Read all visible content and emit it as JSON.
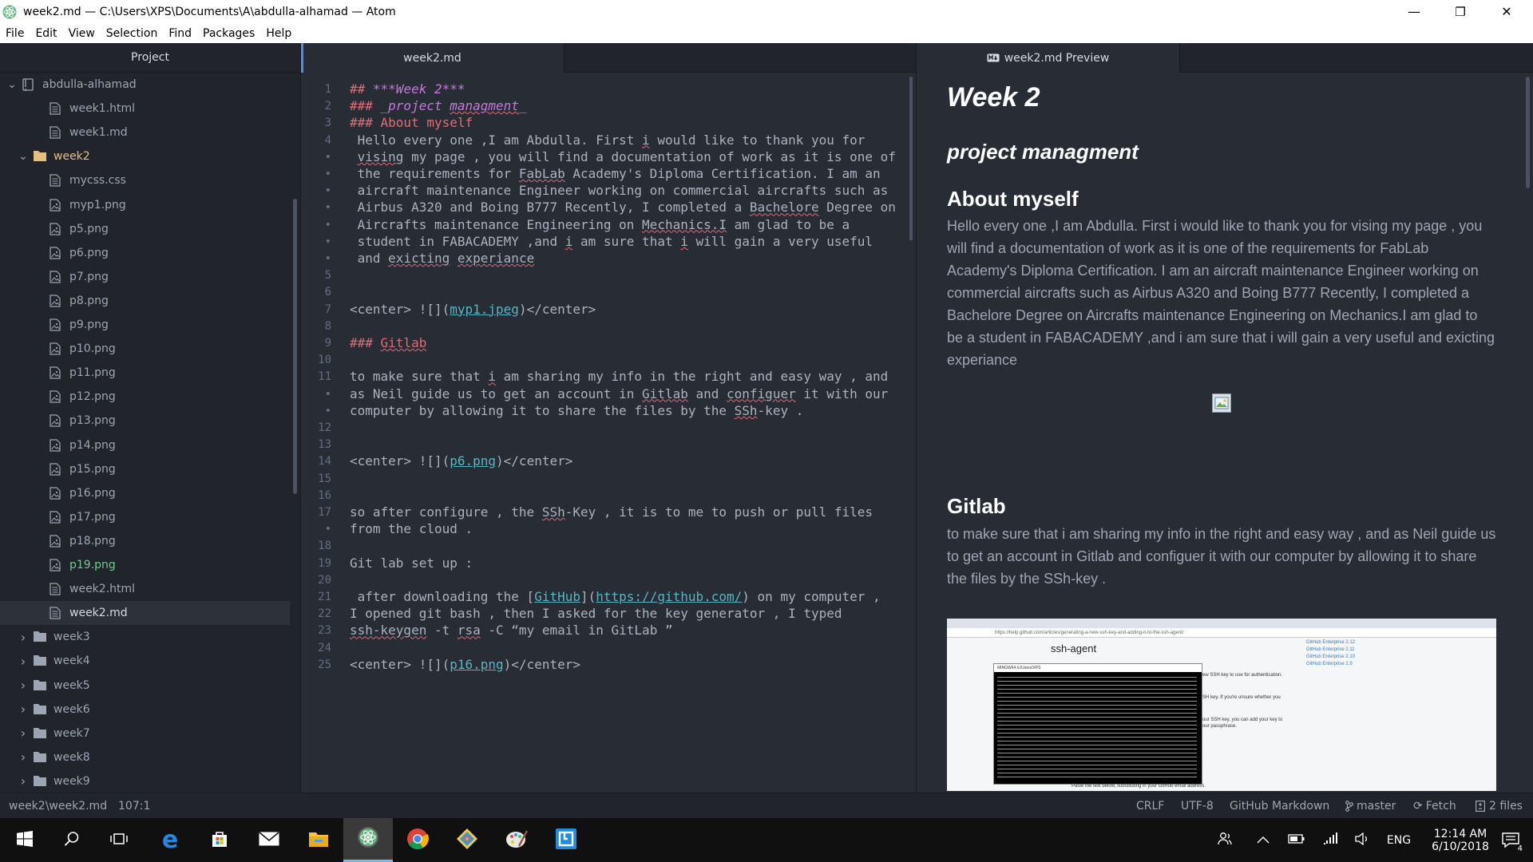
{
  "window": {
    "title": "week2.md — C:\\Users\\XPS\\Documents\\A\\abdulla-alhamad — Atom",
    "minimize": "—",
    "maximize": "❐",
    "close": "✕"
  },
  "menu": [
    "File",
    "Edit",
    "View",
    "Selection",
    "Find",
    "Packages",
    "Help"
  ],
  "tree": {
    "header": "Project",
    "items": [
      {
        "label": "abdulla-alhamad",
        "type": "repo",
        "depth": 0,
        "expanded": true
      },
      {
        "label": "week1.html",
        "type": "file",
        "depth": 2
      },
      {
        "label": "week1.md",
        "type": "file",
        "depth": 2
      },
      {
        "label": "week2",
        "type": "folder",
        "depth": 1,
        "expanded": true,
        "open": true
      },
      {
        "label": "mycss.css",
        "type": "file",
        "depth": 2
      },
      {
        "label": "myp1.png",
        "type": "image",
        "depth": 2
      },
      {
        "label": "p5.png",
        "type": "image",
        "depth": 2
      },
      {
        "label": "p6.png",
        "type": "image",
        "depth": 2
      },
      {
        "label": "p7.png",
        "type": "image",
        "depth": 2
      },
      {
        "label": "p8.png",
        "type": "image",
        "depth": 2
      },
      {
        "label": "p9.png",
        "type": "image",
        "depth": 2
      },
      {
        "label": "p10.png",
        "type": "image",
        "depth": 2
      },
      {
        "label": "p11.png",
        "type": "image",
        "depth": 2
      },
      {
        "label": "p12.png",
        "type": "image",
        "depth": 2
      },
      {
        "label": "p13.png",
        "type": "image",
        "depth": 2
      },
      {
        "label": "p14.png",
        "type": "image",
        "depth": 2
      },
      {
        "label": "p15.png",
        "type": "image",
        "depth": 2
      },
      {
        "label": "p16.png",
        "type": "image",
        "depth": 2
      },
      {
        "label": "p17.png",
        "type": "image",
        "depth": 2
      },
      {
        "label": "p18.png",
        "type": "image",
        "depth": 2
      },
      {
        "label": "p19.png",
        "type": "image",
        "depth": 2,
        "added": true
      },
      {
        "label": "week2.html",
        "type": "file",
        "depth": 2
      },
      {
        "label": "week2.md",
        "type": "file",
        "depth": 2,
        "selected": true
      },
      {
        "label": "week3",
        "type": "folder",
        "depth": 1
      },
      {
        "label": "week4",
        "type": "folder",
        "depth": 1
      },
      {
        "label": "week5",
        "type": "folder",
        "depth": 1
      },
      {
        "label": "week6",
        "type": "folder",
        "depth": 1
      },
      {
        "label": "week7",
        "type": "folder",
        "depth": 1
      },
      {
        "label": "week8",
        "type": "folder",
        "depth": 1
      },
      {
        "label": "week9",
        "type": "folder",
        "depth": 1
      }
    ]
  },
  "editor": {
    "tab": "week2.md",
    "lines": [
      {
        "n": "1",
        "parts": [
          [
            "hdr",
            "## "
          ],
          [
            "hdr-em",
            "***Week 2***"
          ]
        ]
      },
      {
        "n": "2",
        "parts": [
          [
            "hdr",
            "### "
          ],
          [
            "hdr-em",
            "_project "
          ],
          [
            "hdr-em sq",
            "managment"
          ],
          [
            "hdr-em",
            "_"
          ]
        ]
      },
      {
        "n": "3",
        "parts": [
          [
            "hdr",
            "### About myself"
          ]
        ]
      },
      {
        "n": "4",
        "parts": [
          [
            "",
            " Hello every one ,I am Abdulla. First "
          ],
          [
            "sq",
            "i"
          ],
          [
            "",
            " would like to thank you for"
          ]
        ]
      },
      {
        "n": "•",
        "parts": [
          [
            "",
            " "
          ],
          [
            "sq",
            "vising"
          ],
          [
            "",
            " my page , you will find a documentation of work as it is one of"
          ]
        ]
      },
      {
        "n": "•",
        "parts": [
          [
            "",
            " the requirements for "
          ],
          [
            "sq",
            "FabLab"
          ],
          [
            "",
            " Academy's Diploma Certification. I am an"
          ]
        ]
      },
      {
        "n": "•",
        "parts": [
          [
            "",
            " aircraft maintenance Engineer working on commercial aircrafts such as"
          ]
        ]
      },
      {
        "n": "•",
        "parts": [
          [
            "",
            " Airbus A320 and Boing B777 Recently, I completed a "
          ],
          [
            "sq",
            "Bachelore"
          ],
          [
            "",
            " Degree on"
          ]
        ]
      },
      {
        "n": "•",
        "parts": [
          [
            "",
            " Aircrafts maintenance Engineering on "
          ],
          [
            "sq",
            "Mechanics.I"
          ],
          [
            "",
            " am glad to be a"
          ]
        ]
      },
      {
        "n": "•",
        "parts": [
          [
            "",
            " student in FABACADEMY ,and "
          ],
          [
            "sq",
            "i"
          ],
          [
            "",
            " am sure that "
          ],
          [
            "sq",
            "i"
          ],
          [
            "",
            " will gain a very useful"
          ]
        ]
      },
      {
        "n": "•",
        "parts": [
          [
            "",
            " and "
          ],
          [
            "sq",
            "exicting"
          ],
          [
            "",
            " "
          ],
          [
            "sq",
            "experiance"
          ]
        ]
      },
      {
        "n": "5",
        "parts": []
      },
      {
        "n": "6",
        "parts": []
      },
      {
        "n": "7",
        "parts": [
          [
            "",
            "<center> ![]("
          ],
          [
            "url",
            "myp1.jpeg"
          ],
          [
            "",
            ")</center>"
          ]
        ]
      },
      {
        "n": "8",
        "parts": []
      },
      {
        "n": "9",
        "parts": [
          [
            "hdr",
            "### "
          ],
          [
            "hdr sq",
            "Gitlab"
          ]
        ]
      },
      {
        "n": "10",
        "parts": []
      },
      {
        "n": "11",
        "parts": [
          [
            "",
            "to make sure that "
          ],
          [
            "sq",
            "i"
          ],
          [
            "",
            " am sharing my info in the right and easy way , and"
          ]
        ]
      },
      {
        "n": "•",
        "parts": [
          [
            "",
            "as Neil guide us to get an account in "
          ],
          [
            "sq",
            "Gitlab"
          ],
          [
            "",
            " and "
          ],
          [
            "sq",
            "configuer"
          ],
          [
            "",
            " it with our"
          ]
        ]
      },
      {
        "n": "•",
        "parts": [
          [
            "",
            "computer by allowing it to share the files by the "
          ],
          [
            "sq",
            "SSh"
          ],
          [
            "",
            "-key ."
          ]
        ]
      },
      {
        "n": "12",
        "parts": []
      },
      {
        "n": "13",
        "parts": []
      },
      {
        "n": "14",
        "parts": [
          [
            "",
            "<center> ![]("
          ],
          [
            "url",
            "p6.png"
          ],
          [
            "",
            ")</center>"
          ]
        ]
      },
      {
        "n": "15",
        "parts": []
      },
      {
        "n": "16",
        "parts": []
      },
      {
        "n": "17",
        "parts": [
          [
            "",
            "so after configure , the "
          ],
          [
            "sq",
            "SSh"
          ],
          [
            "",
            "-Key , it is to me to push or pull files"
          ]
        ]
      },
      {
        "n": "•",
        "parts": [
          [
            "",
            "from the cloud ."
          ]
        ]
      },
      {
        "n": "18",
        "parts": []
      },
      {
        "n": "19",
        "parts": [
          [
            "",
            "Git lab set up :"
          ]
        ]
      },
      {
        "n": "20",
        "parts": []
      },
      {
        "n": "21",
        "parts": [
          [
            "",
            " after downloading the ["
          ],
          [
            "url",
            "GitHub"
          ],
          [
            "",
            "]("
          ],
          [
            "url",
            "https://github.com/"
          ],
          [
            "",
            ") on my computer ,"
          ]
        ]
      },
      {
        "n": "22",
        "parts": [
          [
            "",
            "I opened git bash , then I asked for the key generator , I typed"
          ]
        ]
      },
      {
        "n": "23",
        "parts": [
          [
            "sq",
            "ssh-keygen"
          ],
          [
            "",
            " -t "
          ],
          [
            "sq",
            "rsa"
          ],
          [
            "",
            " -C “my email in GitLab ”"
          ]
        ]
      },
      {
        "n": "24",
        "parts": []
      },
      {
        "n": "25",
        "parts": [
          [
            "",
            "<center> ![]("
          ],
          [
            "url",
            "p16.png"
          ],
          [
            "",
            ")</center>"
          ]
        ]
      }
    ]
  },
  "preview": {
    "tab": "week2.md Preview",
    "h2": "Week 2",
    "h3a": "project managment",
    "h3b": "About myself",
    "p1": "Hello every one ,I am Abdulla. First i would like to thank you for vising my page , you will find a documentation of work as it is one of the requirements for FabLab Academy's Diploma Certification. I am an aircraft maintenance Engineer working on commercial aircrafts such as Airbus A320 and Boing B777 Recently, I completed a Bachelore Degree on Aircrafts maintenance Engineering on Mechanics.I am glad to be a student in FABACADEMY ,and i am sure that i will gain a very useful and exicting experiance",
    "h3c": "Gitlab",
    "p2": "to make sure that i am sharing my info in the right and easy way , and as Neil guide us to get an account in Gitlab and configuer it with our computer by allowing it to share the files by the SSh-key .",
    "shot": {
      "heading": "ssh-agent",
      "url": "https://help.github.com/articles/generating-a-new-ssh-key-and-adding-it-to-the-ssh-agent/",
      "console_title": "MINGW64:/c/Users/XPS",
      "side_links": [
        "GitHub Enterprise 2.12",
        "GitHub Enterprise 2.11",
        "GitHub Enterprise 2.10",
        "GitHub Enterprise 2.9"
      ],
      "text1": "ew SSH key to use for authentication.",
      "text2": "SH key. If you're unsure whether you",
      "text3": "our SSH key, you can add your key to",
      "text4": "our passphrase.",
      "footer": "Paste the text below, substituting in your GitHub email address."
    }
  },
  "status": {
    "path": "week2\\week2.md",
    "cursor": "107:1",
    "eol": "CRLF",
    "encoding": "UTF-8",
    "grammar": "GitHub Markdown",
    "branch": "master",
    "fetch": "Fetch",
    "files": "2 files"
  },
  "taskbar": {
    "lang": "ENG",
    "time": "12:14 AM",
    "date": "6/10/2018",
    "notif_count": "4"
  },
  "colors": {
    "accent": "#568af2",
    "header": "#e06c75",
    "emphasis": "#c678dd",
    "link": "#56b6c2",
    "added": "#73c990"
  }
}
